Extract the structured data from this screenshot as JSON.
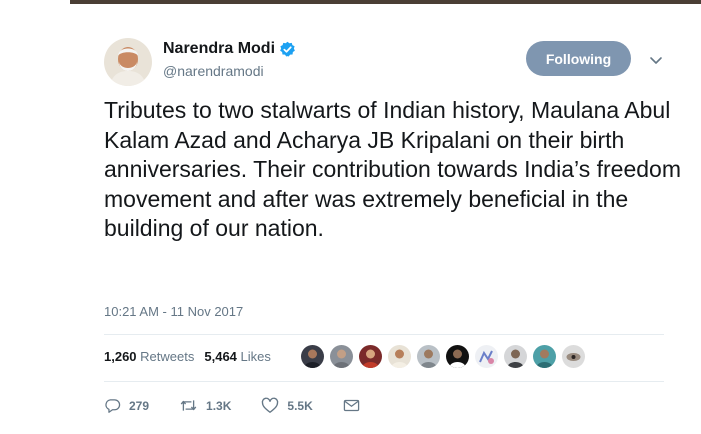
{
  "tweet": {
    "author": {
      "name": "Narendra Modi",
      "handle": "@narendramodi",
      "verified": true,
      "avatar_icon": "profile-photo-man-white-beard"
    },
    "follow_button_label": "Following",
    "more_icon": "chevron-down-icon",
    "text": "Tributes to two stalwarts of Indian history, Maulana Abul Kalam Azad and Acharya JB Kripalani on their birth anniversaries. Their contribution towards India’s freedom movement and after was extremely beneficial in the building of our nation.",
    "timestamp": "10:21 AM - 11 Nov 2017",
    "stats": {
      "retweets_count": "1,260",
      "retweets_label": "Retweets",
      "likes_count": "5,464",
      "likes_label": "Likes"
    },
    "actions": {
      "replies": "279",
      "retweets": "1.3K",
      "likes": "5.5K"
    }
  },
  "colors": {
    "following_button": "#7f96b0",
    "verified_badge": "#1da1f2",
    "muted_text": "#657786",
    "divider": "#e6ecf0"
  }
}
